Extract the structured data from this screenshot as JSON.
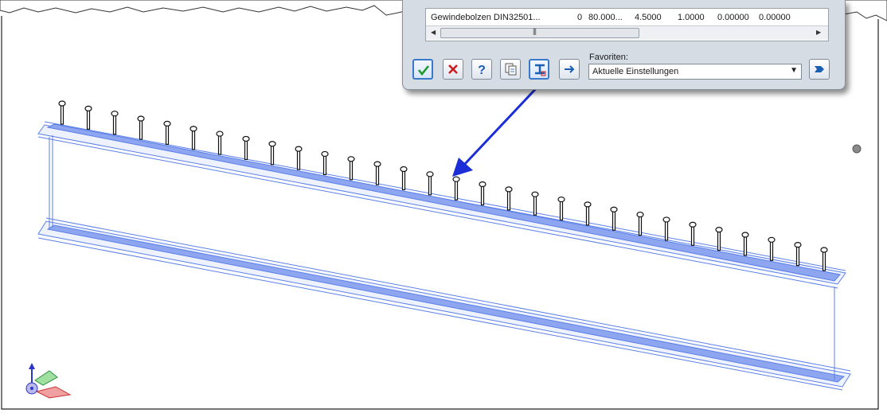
{
  "dialog": {
    "row": {
      "name": "Gewindebolzen DIN32501...",
      "col2": "0",
      "col3": "80.000...",
      "col4": "4.5000",
      "col5": "1.0000",
      "col6": "0.00000",
      "col7": "0.00000"
    },
    "toolbar": {
      "ok_icon": "checkmark-icon",
      "cancel_icon": "x-cancel-icon",
      "help_icon": "question-icon",
      "copy_icon": "copy-document-icon",
      "beam_icon": "beam-select-icon",
      "arrow_icon": "arrow-right-icon"
    },
    "favorites": {
      "label": "Favoriten:",
      "selected": "Aktuelle Einstellungen",
      "apply_icon": "apply-favorite-icon"
    }
  },
  "colors": {
    "beam": "#5b7fe8",
    "annotation_arrow": "#1c2fd6",
    "bolt": "#111111",
    "ok": "#1f9a2e",
    "cancel": "#c91e1e",
    "help": "#1b5fb5"
  },
  "viewport": {
    "bolt_count": 30,
    "axis_icon": "xyz-axis-triad-icon",
    "gizmo_icon": "pivot-point-icon"
  }
}
